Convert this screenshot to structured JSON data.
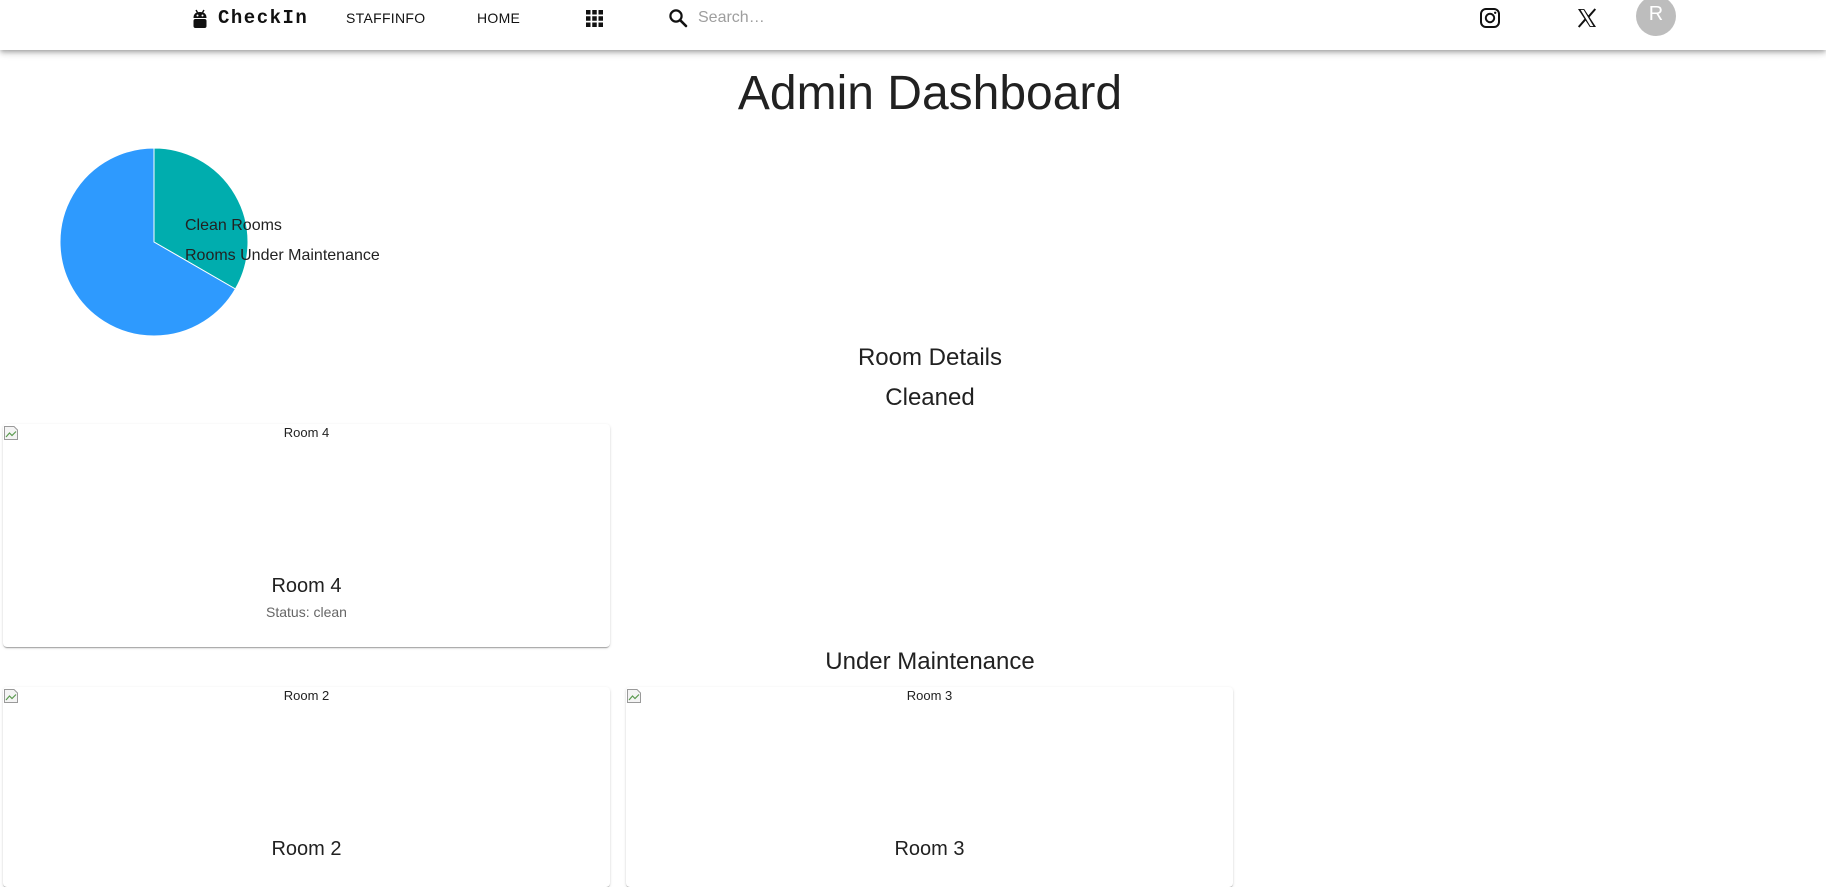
{
  "app": {
    "brand": "CheckIn",
    "nav": [
      "STAFFINFO",
      "HOME"
    ],
    "search_placeholder": "Search…",
    "avatar_initial": "R",
    "icons": [
      "android-icon",
      "apps-grid-icon",
      "search-icon",
      "instagram-icon",
      "x-icon"
    ]
  },
  "page": {
    "title": "Admin Dashboard"
  },
  "chart_data": {
    "type": "pie",
    "categories": [
      "Clean Rooms",
      "Rooms Under Maintenance"
    ],
    "values": [
      1,
      2
    ],
    "colors": [
      "#00ADAE",
      "#2E9AFE"
    ],
    "legend": "overlay-right"
  },
  "sections": {
    "details_title": "Room Details",
    "cleaned_title": "Cleaned",
    "maintenance_title": "Under Maintenance"
  },
  "cleaned_rooms": [
    {
      "image_alt": "Room 4",
      "title": "Room 4",
      "status": "Status: clean"
    }
  ],
  "maintenance_rooms": [
    {
      "image_alt": "Room 2",
      "title": "Room 2"
    },
    {
      "image_alt": "Room 3",
      "title": "Room 3"
    }
  ]
}
